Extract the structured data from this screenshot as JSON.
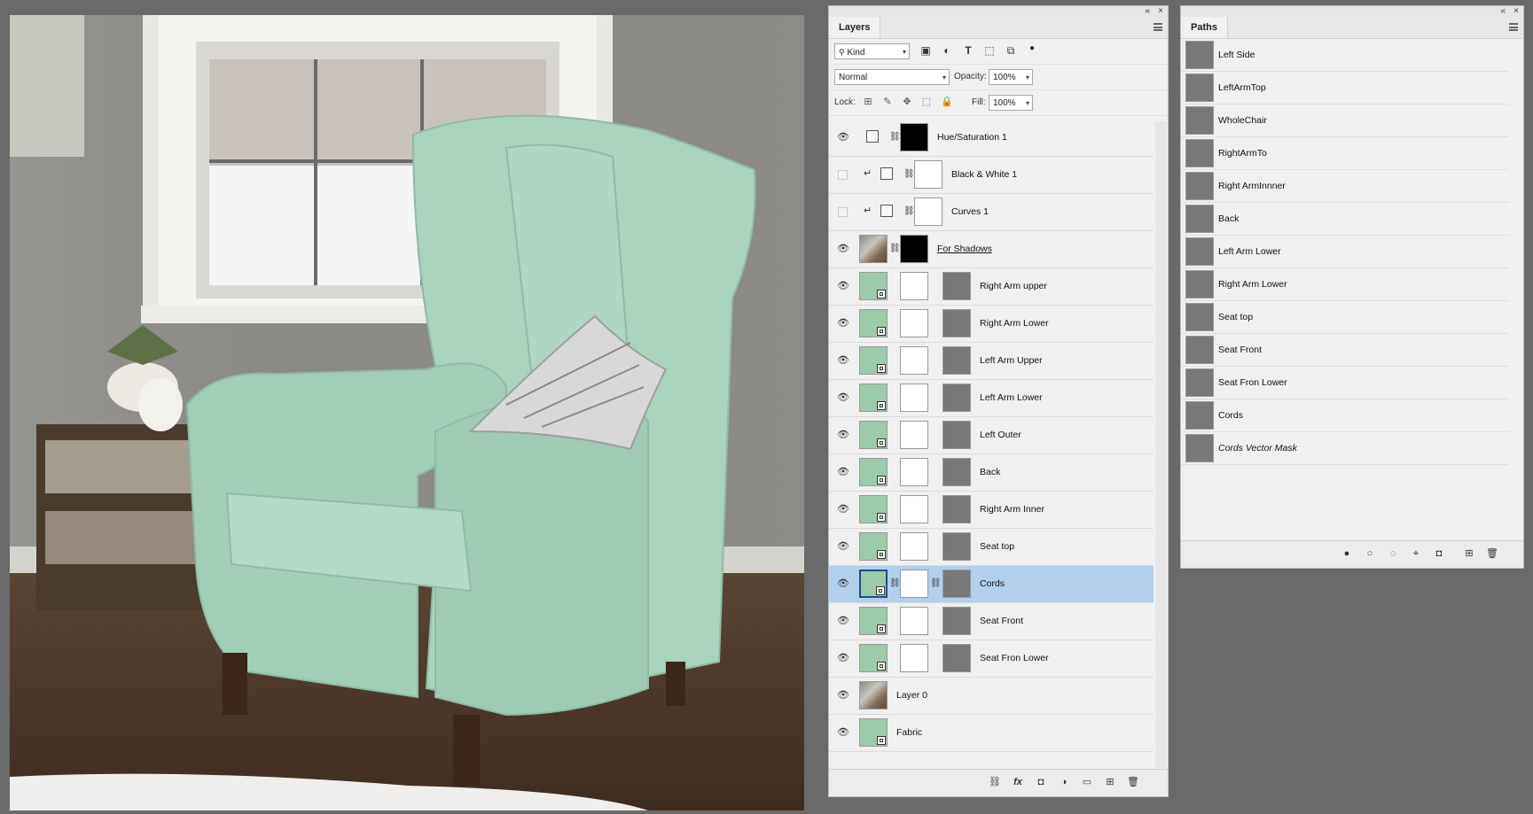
{
  "layers_panel": {
    "tab": "Layers",
    "filter_kind": "Kind",
    "blend_mode": "Normal",
    "opacity_label": "Opacity:",
    "opacity_value": "100%",
    "lock_label": "Lock:",
    "fill_label": "Fill:",
    "fill_value": "100%",
    "layers": [
      {
        "name": "Hue/Saturation 1",
        "visible": true,
        "kind": "adjustment"
      },
      {
        "name": "Black & White 1",
        "visible": false,
        "kind": "adjustment-clipped"
      },
      {
        "name": "Curves 1",
        "visible": false,
        "kind": "adjustment-clipped"
      },
      {
        "name": "For Shadows",
        "visible": true,
        "kind": "photo-mask"
      },
      {
        "name": "Right Arm upper",
        "visible": true,
        "kind": "smart-vector"
      },
      {
        "name": "Right Arm Lower",
        "visible": true,
        "kind": "smart-vector"
      },
      {
        "name": "Left Arm Upper",
        "visible": true,
        "kind": "smart-vector"
      },
      {
        "name": "Left Arm Lower",
        "visible": true,
        "kind": "smart-vector"
      },
      {
        "name": "Left Outer",
        "visible": true,
        "kind": "smart-vector"
      },
      {
        "name": "Back",
        "visible": true,
        "kind": "smart-vector"
      },
      {
        "name": "Right Arm Inner",
        "visible": true,
        "kind": "smart-vector"
      },
      {
        "name": "Seat top",
        "visible": true,
        "kind": "smart-vector"
      },
      {
        "name": "Cords",
        "visible": true,
        "kind": "smart-vector",
        "selected": true
      },
      {
        "name": "Seat Front",
        "visible": true,
        "kind": "smart-vector"
      },
      {
        "name": "Seat Fron Lower",
        "visible": true,
        "kind": "smart-vector"
      },
      {
        "name": "Layer 0",
        "visible": true,
        "kind": "photo"
      },
      {
        "name": "Fabric",
        "visible": true,
        "kind": "smart"
      }
    ]
  },
  "paths_panel": {
    "tab": "Paths",
    "paths": [
      {
        "name": "Left Side"
      },
      {
        "name": "LeftArmTop"
      },
      {
        "name": "WholeChair"
      },
      {
        "name": "RightArmTo"
      },
      {
        "name": "Right ArmInnner"
      },
      {
        "name": "Back"
      },
      {
        "name": "Left Arm Lower"
      },
      {
        "name": "Right Arm Lower"
      },
      {
        "name": "Seat top"
      },
      {
        "name": "Seat Front"
      },
      {
        "name": "Seat Fron Lower"
      },
      {
        "name": "Cords"
      },
      {
        "name": "Cords Vector Mask",
        "italic": true
      }
    ]
  },
  "colors": {
    "workspace": "#6a6a6a",
    "panel": "#f0f0f0",
    "selection": "#b2cfec",
    "fabric": "#9ccbaa"
  },
  "icons": {
    "visibility": "eye-icon",
    "panel_collapse": "double-chevron-icon",
    "panel_close": "close-icon"
  }
}
